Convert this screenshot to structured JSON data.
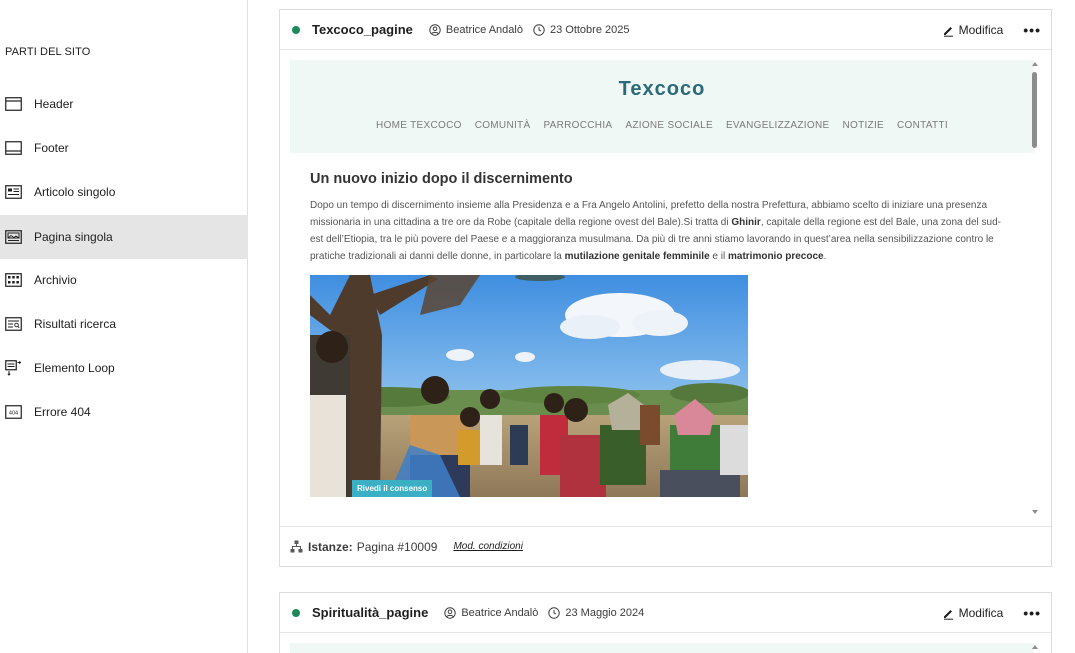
{
  "sidebar": {
    "heading": "PARTI DEL SITO",
    "items": [
      {
        "label": "Header",
        "icon": "header-layout-icon",
        "active": false
      },
      {
        "label": "Footer",
        "icon": "footer-layout-icon",
        "active": false
      },
      {
        "label": "Articolo singolo",
        "icon": "single-post-icon",
        "active": false
      },
      {
        "label": "Pagina singola",
        "icon": "single-page-icon",
        "active": true
      },
      {
        "label": "Archivio",
        "icon": "archive-icon",
        "active": false
      },
      {
        "label": "Risultati ricerca",
        "icon": "search-results-icon",
        "active": false
      },
      {
        "label": "Elemento Loop",
        "icon": "loop-item-icon",
        "active": false
      },
      {
        "label": "Errore 404",
        "icon": "error-404-icon",
        "active": false
      }
    ]
  },
  "cards": [
    {
      "title": "Texcoco_pagine",
      "author": "Beatrice Andalò",
      "date": "23 Ottobre 2025",
      "edit_label": "Modifica",
      "more_label": "•••",
      "preview": {
        "logo": "Texcoco",
        "nav": [
          "HOME TEXCOCO",
          "COMUNITÀ",
          "PARROCCHIA",
          "AZIONE SOCIALE",
          "EVANGELIZZAZIONE",
          "NOTIZIE",
          "CONTATTI"
        ],
        "article_title": "Un nuovo inizio dopo il discernimento",
        "p_intro": "Dopo un tempo di discernimento insieme alla Presidenza e a Fra Angelo Antolini, prefetto della nostra Prefettura, abbiamo scelto di iniziare una presenza missionaria in una cittadina a tre ore da Robe (capitale della regione ovest del Bale).Si tratta di ",
        "p_bold1": "Ghinir",
        "p_mid": ", capitale della regione est del Bale, una zona del sud-est dell’Etiopia, tra le più povere del Paese e a maggioranza musulmana. Da più di tre anni stiamo lavorando in quest’area nella sensibilizzazione contro le pratiche tradizionali ai danni delle donne, in particolare la ",
        "p_bold2": "mutilazione genitale femminile",
        "p_and": " e il ",
        "p_bold3": "matrimonio precoce",
        "p_end": ".",
        "consent_label": "Rivedi il consenso"
      },
      "instances_label": "Istanze:",
      "instances_value": "Pagina #10009",
      "conditions_label": "Mod. condizioni"
    },
    {
      "title": "Spiritualità_pagine",
      "author": "Beatrice Andalò",
      "date": "23 Maggio 2024",
      "edit_label": "Modifica",
      "more_label": "•••"
    }
  ],
  "colors": {
    "status_active": "#1b8a5a",
    "site_logo": "#2b6a78",
    "site_header_bg": "#f0f8f6",
    "consent_bg": "#3bb0c5",
    "sidebar_active_bg": "#e5e5e5"
  }
}
